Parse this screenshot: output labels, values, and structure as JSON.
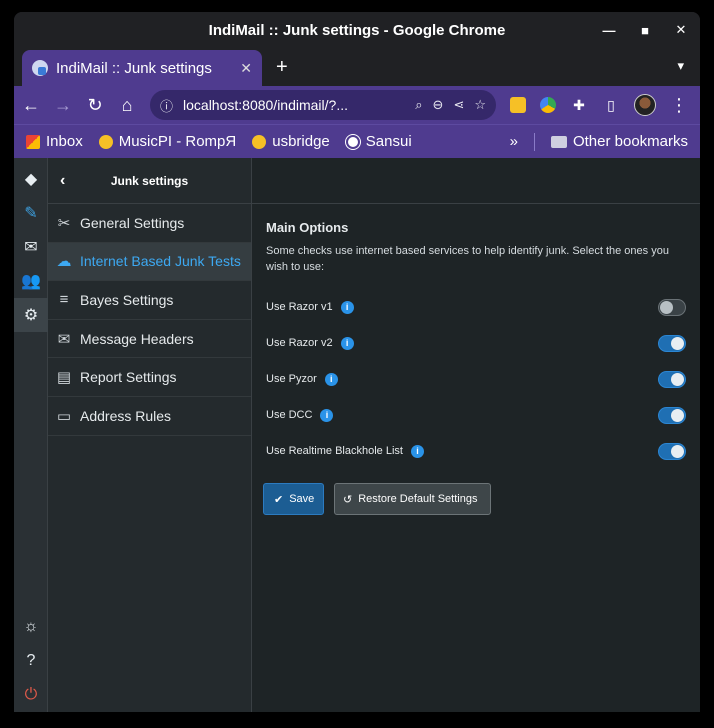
{
  "window": {
    "title": "IndiMail :: Junk settings - Google Chrome"
  },
  "tab": {
    "title": "IndiMail :: Junk settings"
  },
  "address": {
    "url": "localhost:8080/indimail/?..."
  },
  "bookmarks": [
    {
      "label": "Inbox",
      "icon": "gmail-icon"
    },
    {
      "label": "MusicPI - RompЯ",
      "icon": "play-icon"
    },
    {
      "label": "usbridge",
      "icon": "play-icon"
    },
    {
      "label": "Sansui",
      "icon": "globe-icon"
    }
  ],
  "bookmarks_overflow": "»",
  "other_bookmarks": "Other bookmarks",
  "sidebar": {
    "title": "Junk settings",
    "items": [
      {
        "label": "General Settings",
        "icon": "tools-icon",
        "active": false
      },
      {
        "label": "Internet Based Junk Tests",
        "icon": "cloud-icon",
        "active": true
      },
      {
        "label": "Bayes Settings",
        "icon": "database-icon",
        "active": false
      },
      {
        "label": "Message Headers",
        "icon": "envelope-icon",
        "active": false
      },
      {
        "label": "Report Settings",
        "icon": "document-icon",
        "active": false
      },
      {
        "label": "Address Rules",
        "icon": "address-card-icon",
        "active": false
      }
    ]
  },
  "main": {
    "heading": "Main Options",
    "description": "Some checks use internet based services to help identify junk. Select the ones you wish to use:",
    "options": [
      {
        "label": "Use Razor v1",
        "enabled": false
      },
      {
        "label": "Use Razor v2",
        "enabled": true
      },
      {
        "label": "Use Pyzor",
        "enabled": true
      },
      {
        "label": "Use DCC",
        "enabled": true
      },
      {
        "label": "Use Realtime Blackhole List",
        "enabled": true
      }
    ],
    "save_label": "Save",
    "restore_label": "Restore Default Settings"
  },
  "colors": {
    "accent": "#3da9f2",
    "browser_chrome": "#4f3b8f",
    "toggle_on": "#1f6fb3"
  }
}
